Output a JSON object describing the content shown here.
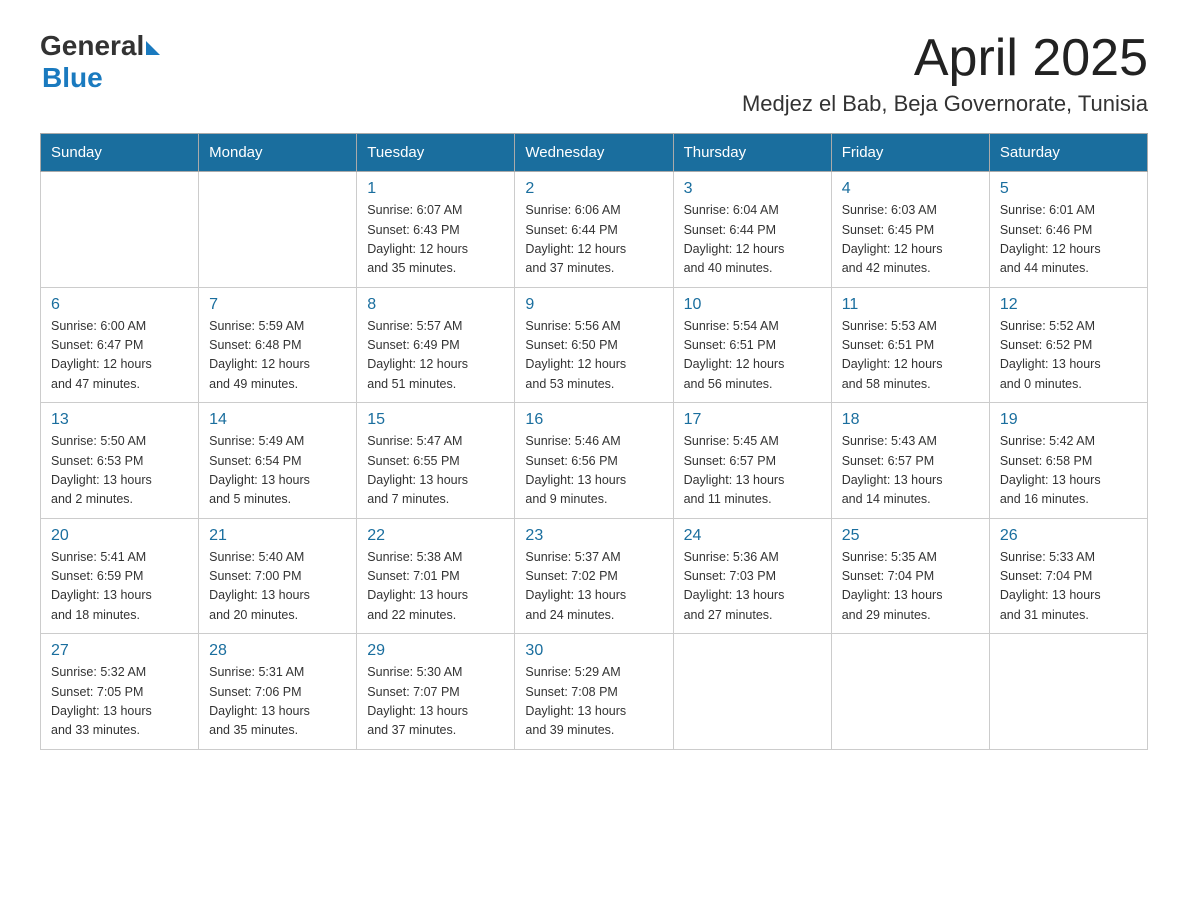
{
  "header": {
    "logo_general": "General",
    "logo_blue": "Blue",
    "month_title": "April 2025",
    "location": "Medjez el Bab, Beja Governorate, Tunisia"
  },
  "weekdays": [
    "Sunday",
    "Monday",
    "Tuesday",
    "Wednesday",
    "Thursday",
    "Friday",
    "Saturday"
  ],
  "weeks": [
    [
      {
        "day": "",
        "info": ""
      },
      {
        "day": "",
        "info": ""
      },
      {
        "day": "1",
        "info": "Sunrise: 6:07 AM\nSunset: 6:43 PM\nDaylight: 12 hours\nand 35 minutes."
      },
      {
        "day": "2",
        "info": "Sunrise: 6:06 AM\nSunset: 6:44 PM\nDaylight: 12 hours\nand 37 minutes."
      },
      {
        "day": "3",
        "info": "Sunrise: 6:04 AM\nSunset: 6:44 PM\nDaylight: 12 hours\nand 40 minutes."
      },
      {
        "day": "4",
        "info": "Sunrise: 6:03 AM\nSunset: 6:45 PM\nDaylight: 12 hours\nand 42 minutes."
      },
      {
        "day": "5",
        "info": "Sunrise: 6:01 AM\nSunset: 6:46 PM\nDaylight: 12 hours\nand 44 minutes."
      }
    ],
    [
      {
        "day": "6",
        "info": "Sunrise: 6:00 AM\nSunset: 6:47 PM\nDaylight: 12 hours\nand 47 minutes."
      },
      {
        "day": "7",
        "info": "Sunrise: 5:59 AM\nSunset: 6:48 PM\nDaylight: 12 hours\nand 49 minutes."
      },
      {
        "day": "8",
        "info": "Sunrise: 5:57 AM\nSunset: 6:49 PM\nDaylight: 12 hours\nand 51 minutes."
      },
      {
        "day": "9",
        "info": "Sunrise: 5:56 AM\nSunset: 6:50 PM\nDaylight: 12 hours\nand 53 minutes."
      },
      {
        "day": "10",
        "info": "Sunrise: 5:54 AM\nSunset: 6:51 PM\nDaylight: 12 hours\nand 56 minutes."
      },
      {
        "day": "11",
        "info": "Sunrise: 5:53 AM\nSunset: 6:51 PM\nDaylight: 12 hours\nand 58 minutes."
      },
      {
        "day": "12",
        "info": "Sunrise: 5:52 AM\nSunset: 6:52 PM\nDaylight: 13 hours\nand 0 minutes."
      }
    ],
    [
      {
        "day": "13",
        "info": "Sunrise: 5:50 AM\nSunset: 6:53 PM\nDaylight: 13 hours\nand 2 minutes."
      },
      {
        "day": "14",
        "info": "Sunrise: 5:49 AM\nSunset: 6:54 PM\nDaylight: 13 hours\nand 5 minutes."
      },
      {
        "day": "15",
        "info": "Sunrise: 5:47 AM\nSunset: 6:55 PM\nDaylight: 13 hours\nand 7 minutes."
      },
      {
        "day": "16",
        "info": "Sunrise: 5:46 AM\nSunset: 6:56 PM\nDaylight: 13 hours\nand 9 minutes."
      },
      {
        "day": "17",
        "info": "Sunrise: 5:45 AM\nSunset: 6:57 PM\nDaylight: 13 hours\nand 11 minutes."
      },
      {
        "day": "18",
        "info": "Sunrise: 5:43 AM\nSunset: 6:57 PM\nDaylight: 13 hours\nand 14 minutes."
      },
      {
        "day": "19",
        "info": "Sunrise: 5:42 AM\nSunset: 6:58 PM\nDaylight: 13 hours\nand 16 minutes."
      }
    ],
    [
      {
        "day": "20",
        "info": "Sunrise: 5:41 AM\nSunset: 6:59 PM\nDaylight: 13 hours\nand 18 minutes."
      },
      {
        "day": "21",
        "info": "Sunrise: 5:40 AM\nSunset: 7:00 PM\nDaylight: 13 hours\nand 20 minutes."
      },
      {
        "day": "22",
        "info": "Sunrise: 5:38 AM\nSunset: 7:01 PM\nDaylight: 13 hours\nand 22 minutes."
      },
      {
        "day": "23",
        "info": "Sunrise: 5:37 AM\nSunset: 7:02 PM\nDaylight: 13 hours\nand 24 minutes."
      },
      {
        "day": "24",
        "info": "Sunrise: 5:36 AM\nSunset: 7:03 PM\nDaylight: 13 hours\nand 27 minutes."
      },
      {
        "day": "25",
        "info": "Sunrise: 5:35 AM\nSunset: 7:04 PM\nDaylight: 13 hours\nand 29 minutes."
      },
      {
        "day": "26",
        "info": "Sunrise: 5:33 AM\nSunset: 7:04 PM\nDaylight: 13 hours\nand 31 minutes."
      }
    ],
    [
      {
        "day": "27",
        "info": "Sunrise: 5:32 AM\nSunset: 7:05 PM\nDaylight: 13 hours\nand 33 minutes."
      },
      {
        "day": "28",
        "info": "Sunrise: 5:31 AM\nSunset: 7:06 PM\nDaylight: 13 hours\nand 35 minutes."
      },
      {
        "day": "29",
        "info": "Sunrise: 5:30 AM\nSunset: 7:07 PM\nDaylight: 13 hours\nand 37 minutes."
      },
      {
        "day": "30",
        "info": "Sunrise: 5:29 AM\nSunset: 7:08 PM\nDaylight: 13 hours\nand 39 minutes."
      },
      {
        "day": "",
        "info": ""
      },
      {
        "day": "",
        "info": ""
      },
      {
        "day": "",
        "info": ""
      }
    ]
  ]
}
